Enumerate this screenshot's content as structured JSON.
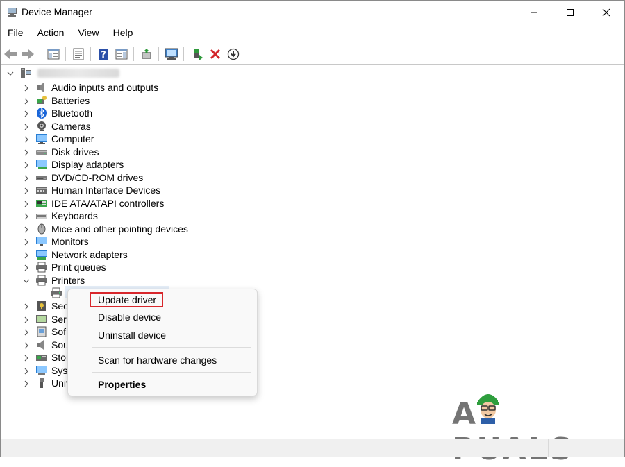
{
  "window": {
    "title": "Device Manager",
    "minimize_glyph": "—",
    "maximize_glyph": "☐",
    "close_glyph": "✕"
  },
  "menu": [
    "File",
    "Action",
    "View",
    "Help"
  ],
  "toolbar": {
    "icons": [
      "back-arrow-icon",
      "forward-arrow-icon",
      "device-list-view-icon",
      "properties-sheet-icon",
      "help-icon",
      "action-pane-icon",
      "update-driver-icon",
      "scan-hardware-icon",
      "enable-device-icon",
      "remove-device-icon",
      "download-driver-icon"
    ]
  },
  "tree": {
    "categories": [
      {
        "label": "Audio inputs and outputs",
        "icon": "speaker-icon"
      },
      {
        "label": "Batteries",
        "icon": "battery-icon"
      },
      {
        "label": "Bluetooth",
        "icon": "bluetooth-icon"
      },
      {
        "label": "Cameras",
        "icon": "camera-icon"
      },
      {
        "label": "Computer",
        "icon": "computer-icon"
      },
      {
        "label": "Disk drives",
        "icon": "disk-drive-icon"
      },
      {
        "label": "Display adapters",
        "icon": "display-adapter-icon"
      },
      {
        "label": "DVD/CD-ROM drives",
        "icon": "dvd-drive-icon"
      },
      {
        "label": "Human Interface Devices",
        "icon": "hid-icon"
      },
      {
        "label": "IDE ATA/ATAPI controllers",
        "icon": "ide-controller-icon"
      },
      {
        "label": "Keyboards",
        "icon": "keyboard-icon"
      },
      {
        "label": "Mice and other pointing devices",
        "icon": "mouse-icon"
      },
      {
        "label": "Monitors",
        "icon": "monitor-icon"
      },
      {
        "label": "Network adapters",
        "icon": "network-adapter-icon"
      },
      {
        "label": "Print queues",
        "icon": "print-queue-icon"
      },
      {
        "label": "Printers",
        "icon": "printer-icon",
        "expanded": true
      }
    ],
    "printer_child_icon": "printer-icon",
    "partial_categories": [
      {
        "label": "Sec",
        "icon": "security-device-icon"
      },
      {
        "label": "Ser",
        "icon": "sensor-icon"
      },
      {
        "label": "Sof",
        "icon": "software-device-icon"
      },
      {
        "label": "Sou",
        "icon": "sound-icon"
      },
      {
        "label": "Stor",
        "icon": "storage-controller-icon"
      },
      {
        "label": "Sys",
        "icon": "system-device-icon"
      },
      {
        "label": "Univ",
        "icon": "usb-icon"
      }
    ]
  },
  "context_menu": {
    "update_driver": "Update driver",
    "disable_device": "Disable device",
    "uninstall_device": "Uninstall device",
    "scan_hardware": "Scan for hardware changes",
    "properties": "Properties"
  },
  "watermark": {
    "text": "A PUALS"
  },
  "colors": {
    "highlight_border": "#d8262b",
    "watermark_green": "#2e9e3d"
  }
}
